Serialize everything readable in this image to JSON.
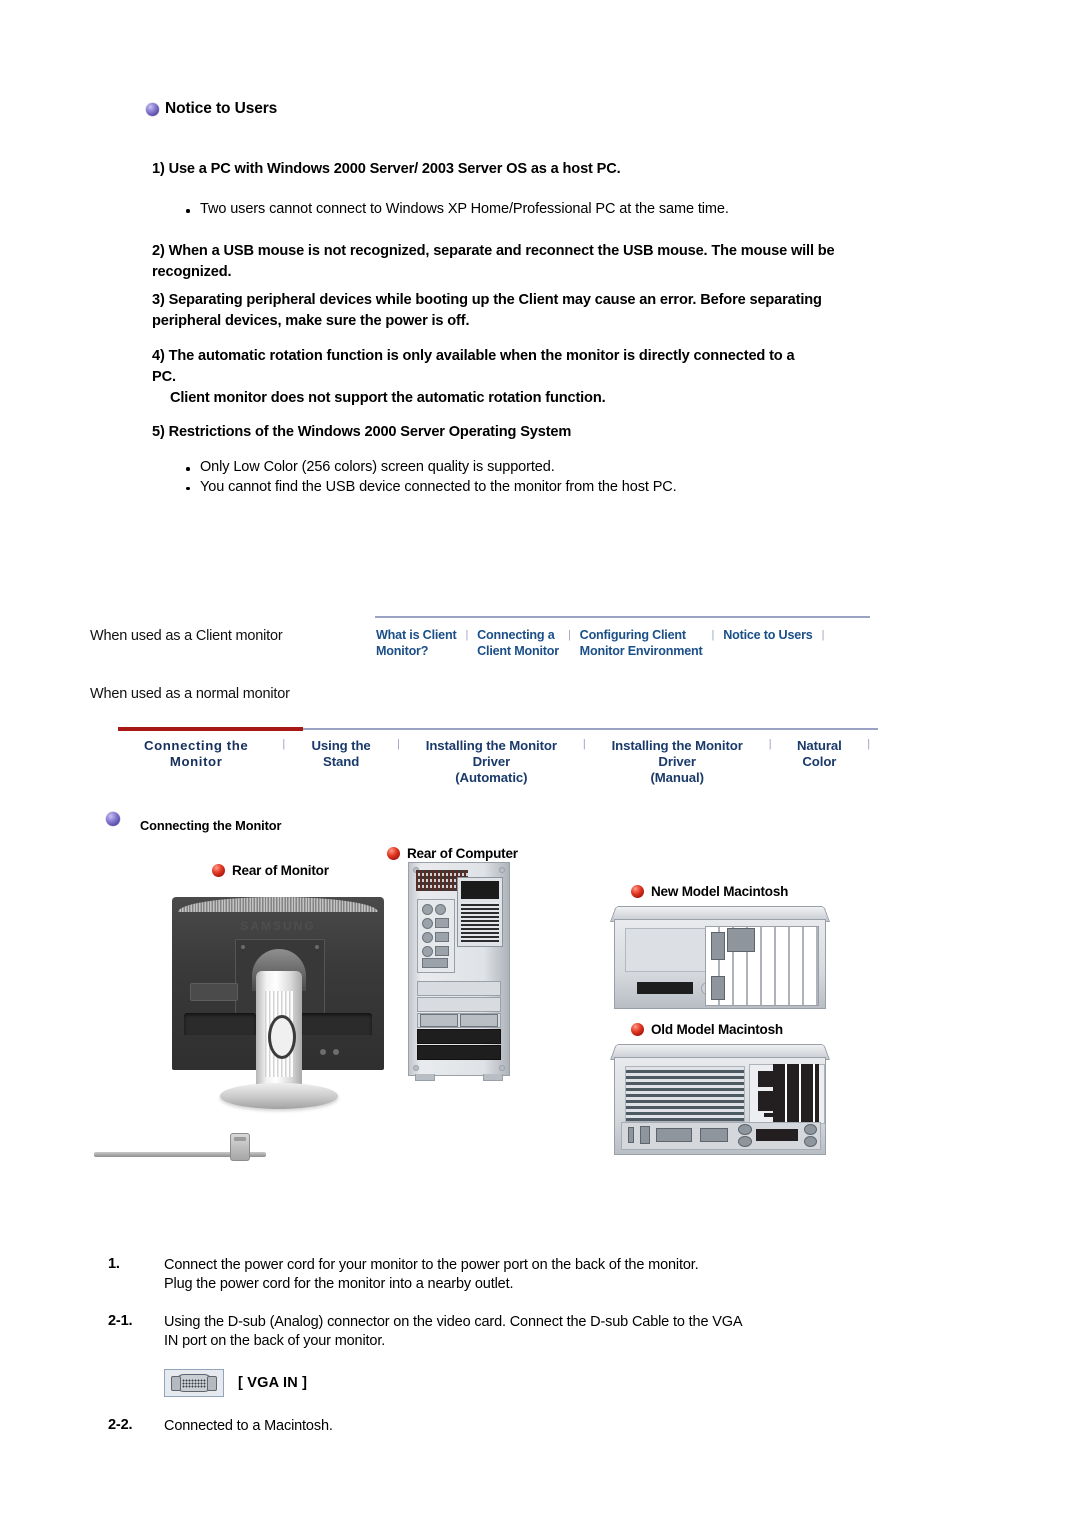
{
  "notice": {
    "heading": "Notice to Users",
    "items": [
      {
        "id": "item-1",
        "title": "1) Use a PC with Windows 2000 Server/ 2003 Server OS as a host PC.",
        "bullets": [
          "Two users cannot connect to Windows XP Home/Professional PC at the same time."
        ]
      },
      {
        "id": "item-2",
        "title": "2) When a USB mouse is not recognized, separate and reconnect the USB mouse. The mouse will be recognized.",
        "bullets": []
      },
      {
        "id": "item-3",
        "title": "3) Separating peripheral devices while booting up the Client may cause an error. Before separating peripheral devices, make sure the power is off.",
        "bullets": []
      },
      {
        "id": "item-4",
        "title": "4) The automatic rotation function is only available when the monitor is directly connected to a PC.",
        "subtitle": "Client monitor does not support the automatic rotation function.",
        "bullets": []
      },
      {
        "id": "item-5",
        "title": "5) Restrictions of the Windows 2000 Server Operating System",
        "bullets": [
          "Only Low Color (256 colors) screen quality is supported.",
          "You cannot find the USB device connected to the monitor from the host PC."
        ]
      }
    ]
  },
  "nav_client": {
    "label": "When used as a\nClient monitor",
    "links": [
      "What is Client\nMonitor?",
      "Connecting a\nClient Monitor",
      "Configuring  Client\nMonitor  Environment",
      "Notice to Users"
    ],
    "separator": "|",
    "rule_color": "#9aa3c4",
    "link_color": "#1a4f88"
  },
  "nav_normal": {
    "label": "When used as a\nnormal monitor",
    "links": [
      "Connecting  the  Monitor",
      "Using the Stand",
      "Installing the Monitor Driver\n(Automatic)",
      "Installing the Monitor Driver\n(Manual)",
      "Natural Color"
    ],
    "active_index": 0,
    "separator": "|",
    "rule_color": "#9aa3c4",
    "accent_color": "#a81916",
    "link_color": "#1a3a6b"
  },
  "section": {
    "title": "Connecting the Monitor",
    "bullet_color": "#6b5fc0"
  },
  "diagram": {
    "labels": {
      "rear_of_monitor": "Rear of Monitor",
      "rear_of_computer": "Rear of Computer",
      "new_model_macintosh": "New Model Macintosh",
      "old_model_macintosh": "Old Model Macintosh"
    },
    "bullet_color": "#cc1100",
    "monitor_brand": "SAMSUNG"
  },
  "steps": [
    {
      "number": "1.",
      "text": "Connect the power cord for your monitor to the power port on the back of the monitor.\nPlug the power cord for the monitor into a nearby outlet."
    },
    {
      "number": "2-1.",
      "text": "Using the D-sub (Analog) connector on the video card. Connect the D-sub Cable to the VGA\nIN port on the back of your monitor."
    },
    {
      "number": "2-2.",
      "text": "Connected to a Macintosh."
    }
  ],
  "vga": {
    "label": "[ VGA IN ]",
    "icon": "vga-connector-icon"
  }
}
